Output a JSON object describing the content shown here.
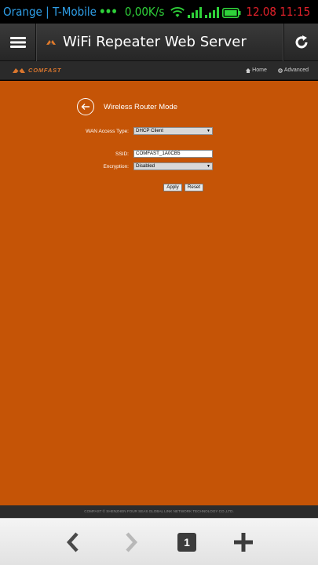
{
  "statusbar": {
    "carrier": "Orange | T-Mobile",
    "dots": "•••",
    "speed": "0,00K/s",
    "time": "12.08 11:15",
    "colors": {
      "carrier": "#2f9fe8",
      "green": "#2fd23a",
      "time": "#e2212a"
    },
    "icons": [
      "wifi-icon",
      "signal-icon",
      "signal-icon",
      "battery-icon"
    ]
  },
  "appbar": {
    "title": "WiFi Repeater Web Server",
    "menu_icon": "hamburger-icon",
    "refresh_icon": "refresh-icon"
  },
  "sitenav": {
    "brand": "COMFAST",
    "links": [
      {
        "label": "Home",
        "icon": "home-icon"
      },
      {
        "label": "Advanced",
        "icon": "gear-icon"
      }
    ]
  },
  "page": {
    "title": "Wireless Router Mode",
    "back_icon": "back-arrow-icon",
    "bg_color": "#c55406"
  },
  "form": {
    "wan_label": "WAN Access Type:",
    "wan_value": "DHCP Client",
    "ssid_label": "SSID:",
    "ssid_value": "COMFAST_1A0CB5",
    "encryption_label": "Encryption:",
    "encryption_value": "Disabled",
    "apply_label": "Apply",
    "reset_label": "Reset"
  },
  "footer": {
    "text": "COMFAST © SHENZHEN FOUR SEAS GLOBAL LINK NETWORK TECHNOLOGY CO.,LTD."
  },
  "bottombar": {
    "back_icon": "chevron-left-icon",
    "forward_icon": "chevron-right-icon",
    "tab_count": "1",
    "new_tab_icon": "plus-icon"
  }
}
